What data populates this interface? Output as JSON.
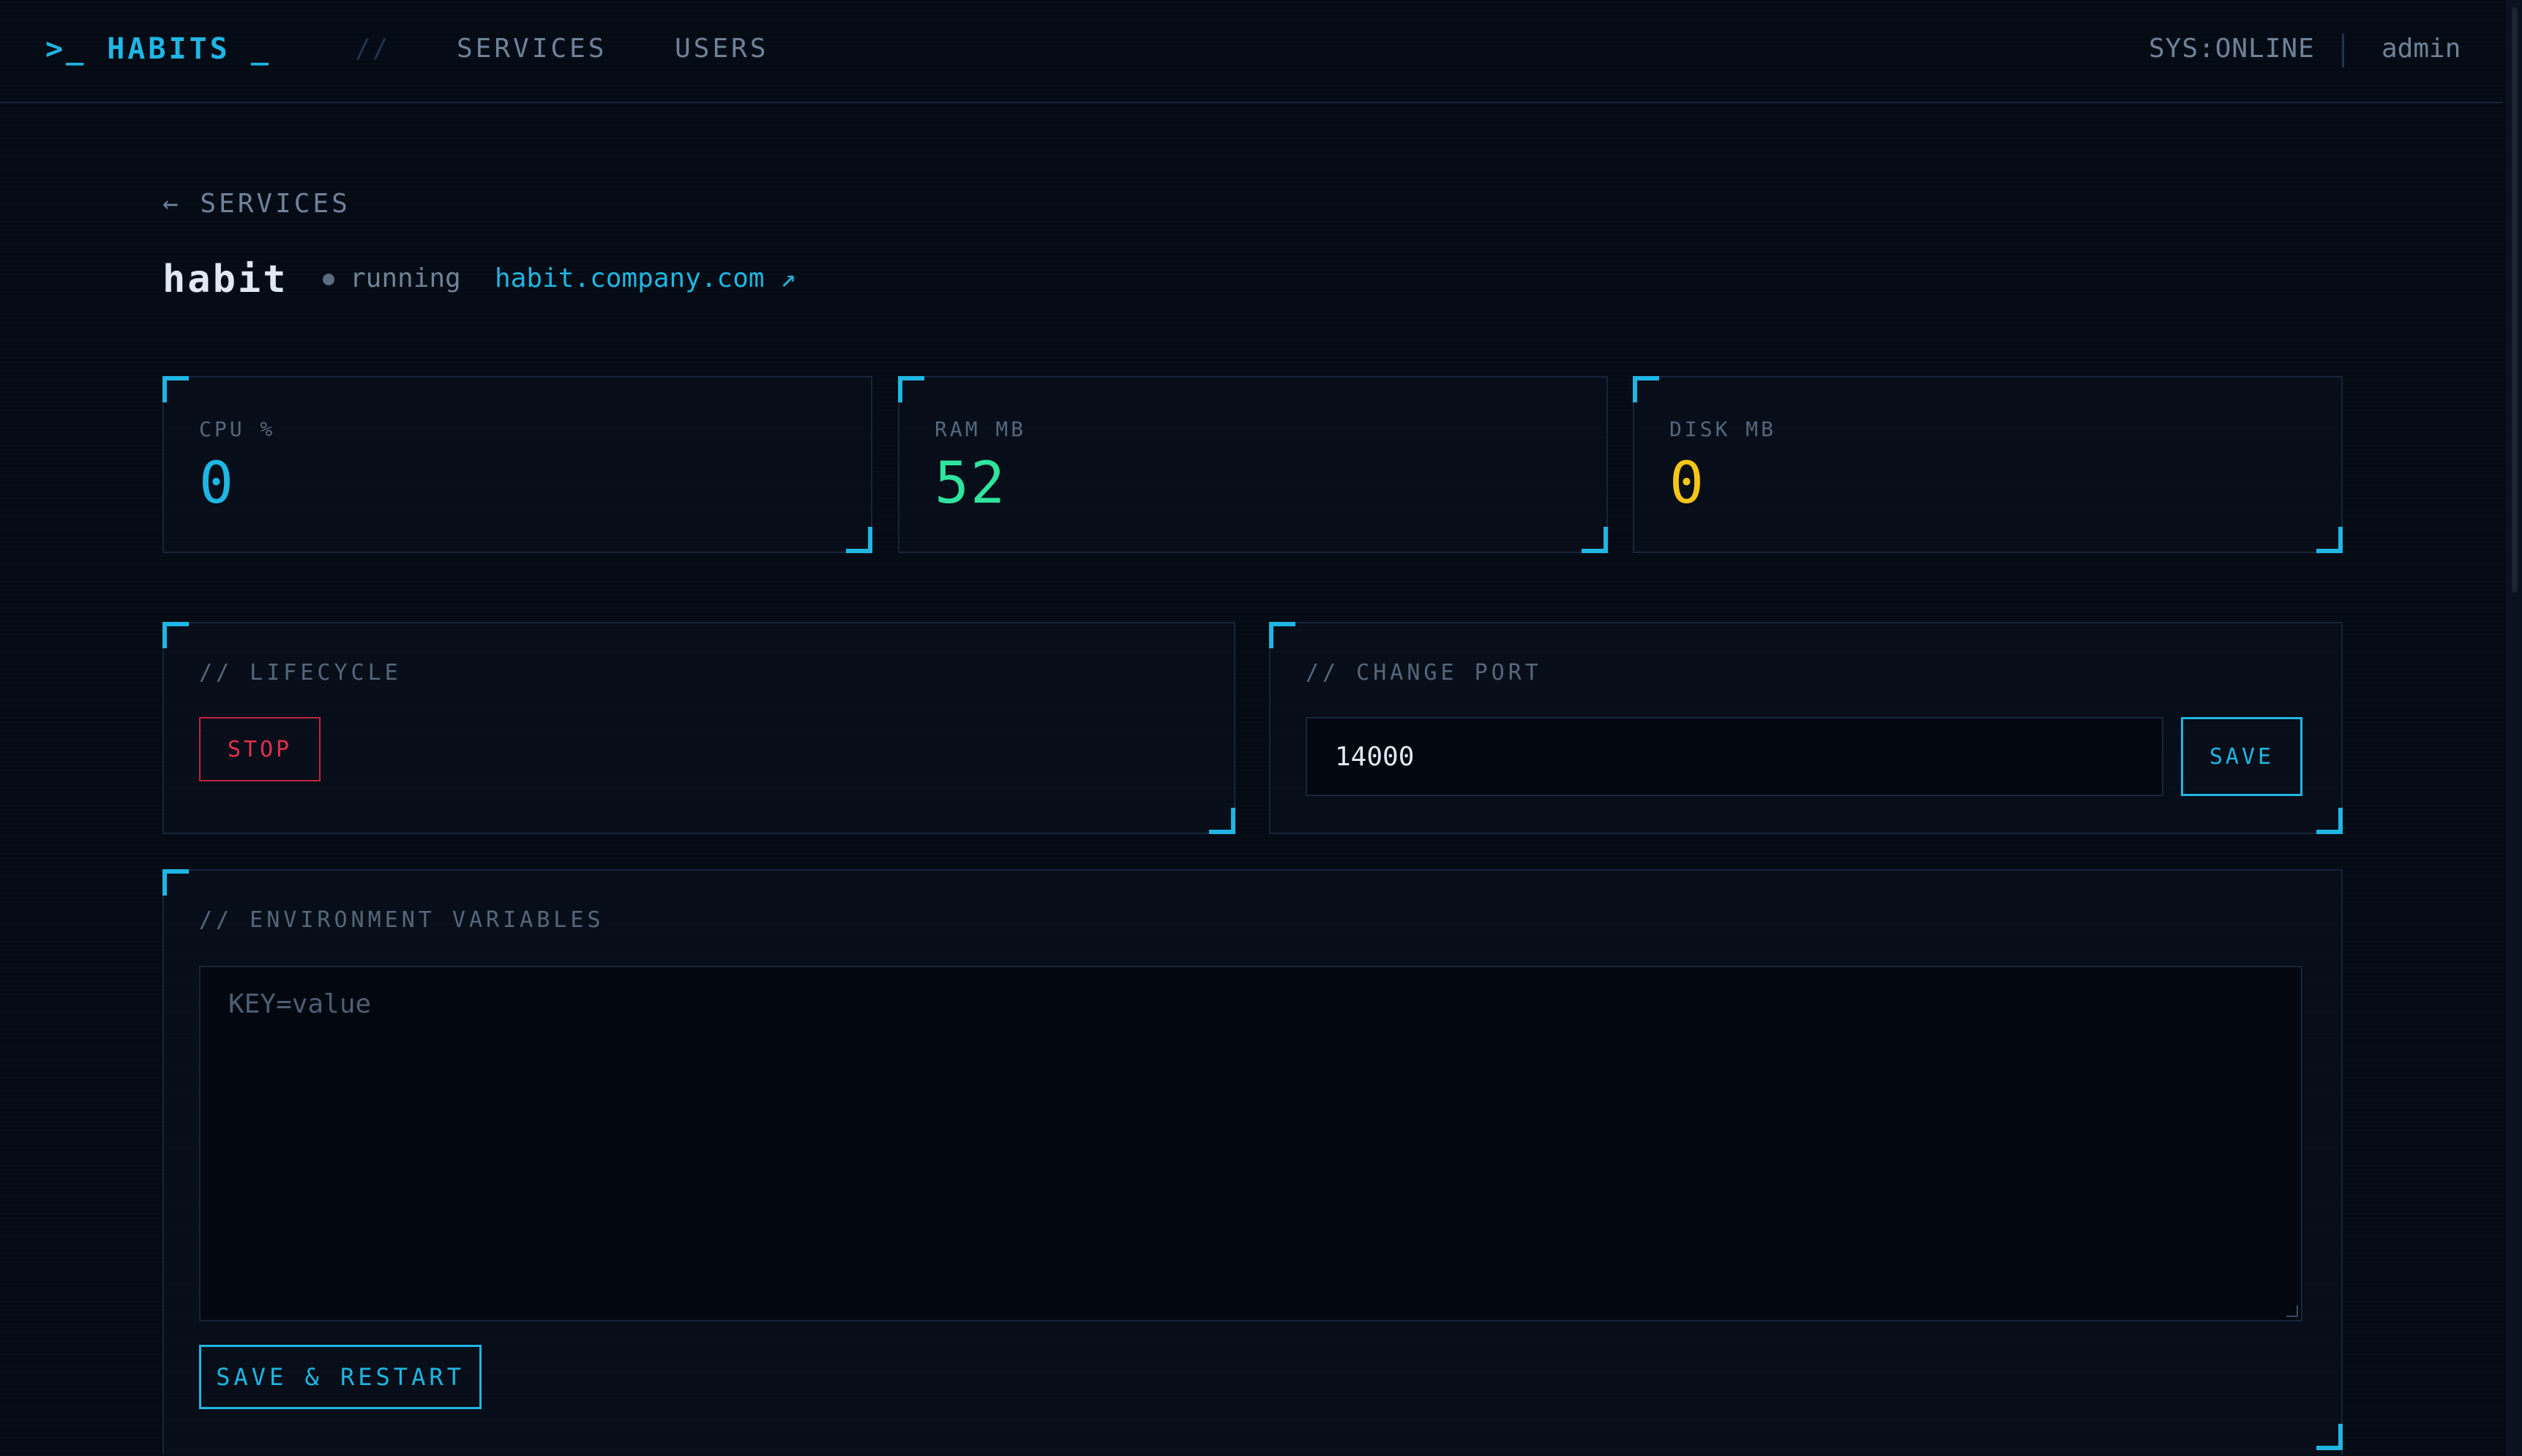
{
  "header": {
    "logo": ">_ HABITS _",
    "separator": "//",
    "nav": [
      {
        "label": "SERVICES"
      },
      {
        "label": "USERS"
      }
    ],
    "sys_status": "SYS:ONLINE",
    "user": "admin"
  },
  "page": {
    "back_label": "← SERVICES",
    "service_name": "habit",
    "status": "running",
    "domain": "habit.company.com ↗"
  },
  "stats": [
    {
      "label": "CPU %",
      "value": "0",
      "color": "#1fb6e4"
    },
    {
      "label": "RAM MB",
      "value": "52",
      "color": "#2ee59d"
    },
    {
      "label": "DISK MB",
      "value": "0",
      "color": "#f5c518"
    }
  ],
  "lifecycle": {
    "label": "// LIFECYCLE",
    "stop_label": "STOP"
  },
  "port": {
    "label": "// CHANGE PORT",
    "value": "14000",
    "save_label": "SAVE"
  },
  "env": {
    "label": "// ENVIRONMENT VARIABLES",
    "placeholder": "KEY=value",
    "save_label": "SAVE & RESTART"
  },
  "colors": {
    "accent": "#1fb6e4",
    "danger": "#e0304e",
    "background": "#050b14"
  }
}
